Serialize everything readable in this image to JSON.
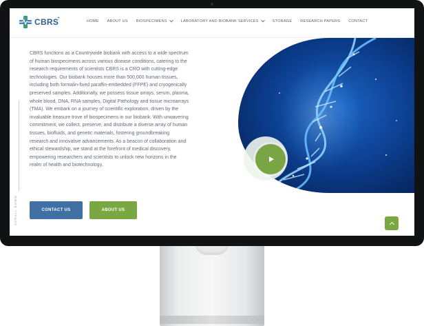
{
  "brand": {
    "name": "CBRS",
    "accent_blue": "#3f6fa3",
    "accent_green": "#79a842"
  },
  "nav": {
    "items": [
      {
        "label": "HOME",
        "dropdown": false
      },
      {
        "label": "ABOUT US",
        "dropdown": false
      },
      {
        "label": "BIOSPECIMENS",
        "dropdown": true
      },
      {
        "label": "LABORATORY AND BIOBANK SERVICES",
        "dropdown": true
      },
      {
        "label": "STORAGE",
        "dropdown": false
      },
      {
        "label": "RESEARCH PAPERS",
        "dropdown": false
      },
      {
        "label": "CONTACT",
        "dropdown": false
      }
    ]
  },
  "main": {
    "intro": "CBRS functions as a Countrywide biobank with access to a wide spectrum of human biospecimens across various disease conditions, catering to the research requirements of scientists CBRS is a CRO with cutting-edge technologies. Our biobank houses more than 500,000 human tissues, including both formalin-fixed paraffin-embedded (FFPE) and cryogenically preserved samples. Additionally, we possess tissue arrays, serum, plasma, whole blood, DNA, RNA samples, Digital Pathology and tissue microarrays (TMA). We embark on a journey of scientific exploration, driven by the invaluable treasure trove of biospecimens in our biobank. With unwavering commitment, we collect, preserve, and distribute a diverse array of human tissues, biofluids, and genetic materials, fostering groundbreaking research and innovative advancements. As a beacon of collaboration and ethical stewardship, we stand at the forefront of medical discovery, empowering researchers and scientists to unlock new horizons in the realm of health and biotechnology.",
    "contact_button": "CONTACT US",
    "about_button": "ABOUT US",
    "scroll_label": "SCROLL DOWN"
  },
  "icons": {
    "play": "play-icon",
    "back_to_top": "chevron-up-icon",
    "dropdown": "chevron-down-icon"
  }
}
